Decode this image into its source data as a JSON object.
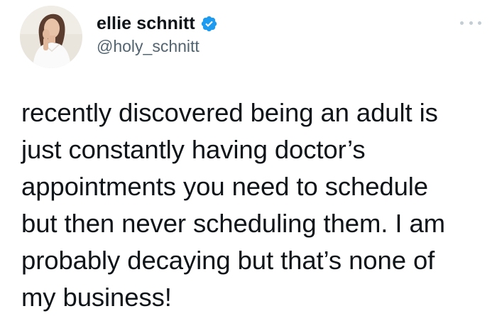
{
  "author": {
    "display_name": "ellie schnitt",
    "handle": "@holy_schnitt",
    "verified": true,
    "avatar_icon": "profile-photo"
  },
  "tweet": {
    "text": "recently discovered being an adult is\njust constantly having doctor’s\nappointments you need to schedule\nbut then never scheduling them. I am\nprobably decaying but that’s none of\nmy business!"
  },
  "menu": {
    "icon": "more-options-icon"
  },
  "colors": {
    "text": "#0f1419",
    "secondary": "#536471",
    "verified_badge": "#1d9bf0",
    "background": "#ffffff"
  }
}
